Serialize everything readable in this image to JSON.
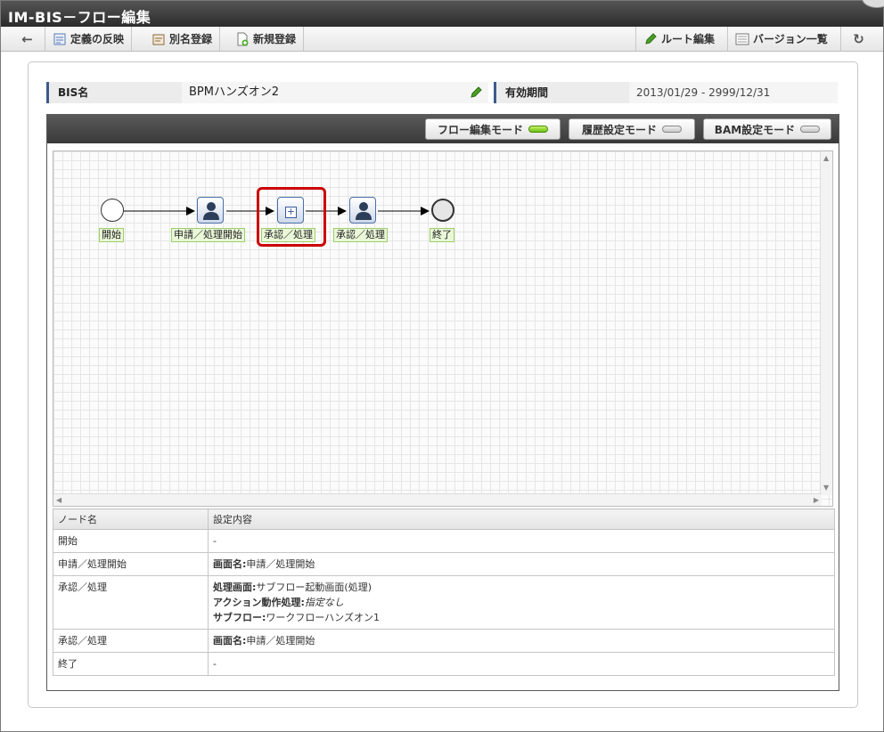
{
  "window": {
    "title": "IM-BIS－フロー編集"
  },
  "toolbar": {
    "back_icon": "back-arrow-icon",
    "reflect_label": "定義の反映",
    "alias_label": "別名登録",
    "new_label": "新規登録",
    "route_label": "ルート編集",
    "version_label": "バージョン一覧",
    "refresh_icon": "refresh-icon"
  },
  "bis": {
    "name_label": "BIS名",
    "name_value": "BPMハンズオン2",
    "period_label": "有効期間",
    "period_value": "2013/01/29 - 2999/12/31"
  },
  "modes": {
    "flow_edit": "フロー編集モード",
    "history": "履歴設定モード",
    "bam": "BAM設定モード",
    "active": "flow_edit"
  },
  "flow": {
    "nodes": [
      {
        "id": "start",
        "type": "start",
        "label": "開始"
      },
      {
        "id": "apply",
        "type": "user-task",
        "label": "申請／処理開始"
      },
      {
        "id": "approve1",
        "type": "subflow-task",
        "label": "承認／処理",
        "selected": true
      },
      {
        "id": "approve2",
        "type": "user-task",
        "label": "承認／処理"
      },
      {
        "id": "end",
        "type": "end",
        "label": "終了"
      }
    ]
  },
  "settings": {
    "headers": [
      "ノード名",
      "設定内容"
    ],
    "rows": [
      {
        "node": "開始",
        "lines": [
          {
            "key": "",
            "value": "-"
          }
        ]
      },
      {
        "node": "申請／処理開始",
        "lines": [
          {
            "key": "画面名:",
            "value": "申請／処理開始"
          }
        ]
      },
      {
        "node": "承認／処理",
        "lines": [
          {
            "key": "処理画面:",
            "value": "サブフロー起動画面(処理)"
          },
          {
            "key": "アクション動作処理:",
            "value": "指定なし",
            "italic": true
          },
          {
            "key": "サブフロー:",
            "value": "ワークフローハンズオン1"
          }
        ]
      },
      {
        "node": "承認／処理",
        "lines": [
          {
            "key": "画面名:",
            "value": "申請／処理開始"
          }
        ]
      },
      {
        "node": "終了",
        "lines": [
          {
            "key": "",
            "value": "-"
          }
        ]
      }
    ]
  }
}
